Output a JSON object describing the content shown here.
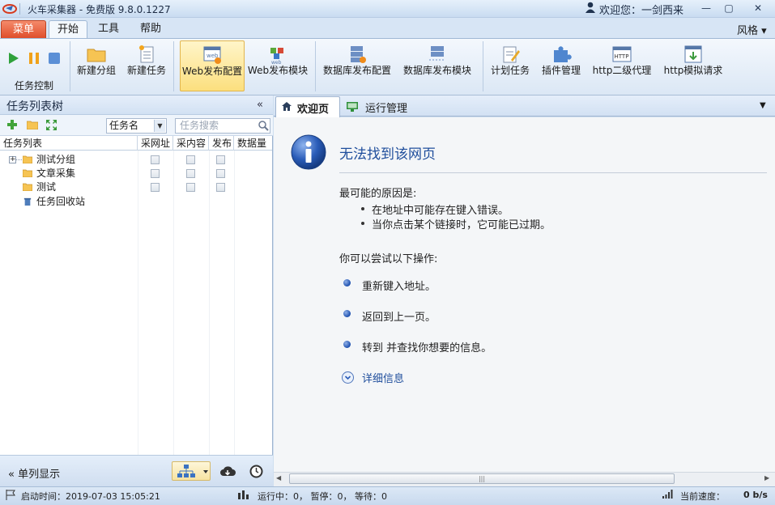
{
  "window": {
    "title": "火车采集器 - 免费版 9.8.0.1227",
    "user_greeting": "欢迎您：一剑西来",
    "minimize": "—",
    "maximize": "▢",
    "close": "✕"
  },
  "ribbon_tabs": {
    "menu": "菜单",
    "start": "开始",
    "tools": "工具",
    "help": "帮助",
    "style": "风格 ▾"
  },
  "ribbon": {
    "task_control": "任务控制",
    "new_group": "新建分组",
    "new_task": "新建任务",
    "web_publish_config": "Web发布配置",
    "web_publish_module": "Web发布模块",
    "db_publish_config": "数据库发布配置",
    "db_publish_module": "数据库发布模块",
    "schedule_task": "计划任务",
    "plugin_manage": "插件管理",
    "http_proxy": "http二级代理",
    "http_simulate": "http模拟请求",
    "web_icon_text": "web",
    "http_icon_text": "HTTP"
  },
  "left_panel": {
    "title": "任务列表树",
    "collapse": "«",
    "filter_select": "任务名",
    "search_placeholder": "任务搜索",
    "columns": [
      "任务列表",
      "采网址",
      "采内容",
      "发布",
      "数据量"
    ],
    "rows": [
      {
        "label": "测试分组",
        "type": "group"
      },
      {
        "label": "文章采集",
        "type": "folder"
      },
      {
        "label": "测试",
        "type": "folder"
      },
      {
        "label": "任务回收站",
        "type": "recycle"
      }
    ],
    "single_column": "单列显示"
  },
  "right_panel": {
    "tabs": [
      "欢迎页",
      "运行管理"
    ],
    "error_title": "无法找到该网页",
    "reason_heading": "最可能的原因是:",
    "reasons": [
      "在地址中可能存在键入错误。",
      "当你点击某个链接时，它可能已过期。"
    ],
    "try_heading": "你可以尝试以下操作:",
    "actions": [
      "重新键入地址。",
      "返回到上一页。",
      "转到  并查找你想要的信息。"
    ],
    "details": "详细信息"
  },
  "status": {
    "start_time": "启动时间：2019-07-03 15:05:21",
    "run_status": "运行中：0， 暂停：0， 等待：0",
    "speed_label": "当前速度：",
    "speed_value": "0 b/s"
  },
  "colors": {
    "accent": "#df4e2b",
    "link": "#1f4e9c",
    "ribbon_highlight": "#fcdf7e"
  }
}
